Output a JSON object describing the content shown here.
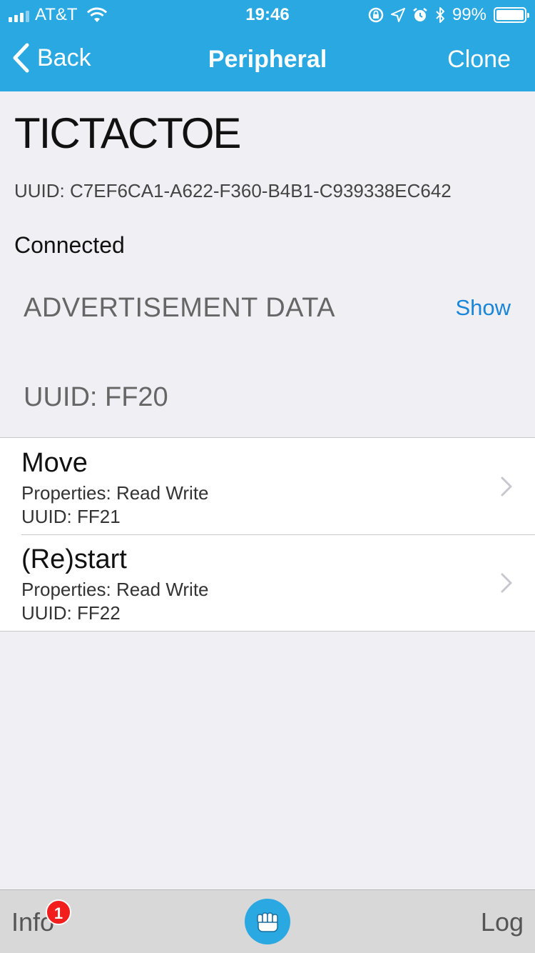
{
  "status_bar": {
    "carrier": "AT&T",
    "time": "19:46",
    "battery": "99%",
    "battery_level": 0.99,
    "icons": [
      "signal-icon",
      "wifi-icon",
      "rotation-lock-icon",
      "location-icon",
      "alarm-icon",
      "bluetooth-icon",
      "battery-icon"
    ]
  },
  "nav": {
    "back_label": "Back",
    "title": "Peripheral",
    "clone_label": "Clone"
  },
  "peripheral": {
    "name": "TICTACTOE",
    "uuid": "UUID: C7EF6CA1-A622-F360-B4B1-C939338EC642",
    "status": "Connected"
  },
  "advertisement": {
    "label": "ADVERTISEMENT DATA",
    "show_label": "Show"
  },
  "service": {
    "uuid": "UUID: FF20"
  },
  "characteristics": [
    {
      "name": "Move",
      "properties": "Properties: Read Write",
      "uuid": "UUID: FF21"
    },
    {
      "name": "(Re)start",
      "properties": "Properties: Read Write",
      "uuid": "UUID: FF22"
    }
  ],
  "tabbar": {
    "info_label": "Info",
    "info_badge": "1",
    "log_label": "Log",
    "center_icon": "fist-icon"
  },
  "colors": {
    "accent": "#2aa8e2",
    "link": "#1a86d8",
    "badge": "#f21d1d",
    "background": "#efeff4"
  }
}
